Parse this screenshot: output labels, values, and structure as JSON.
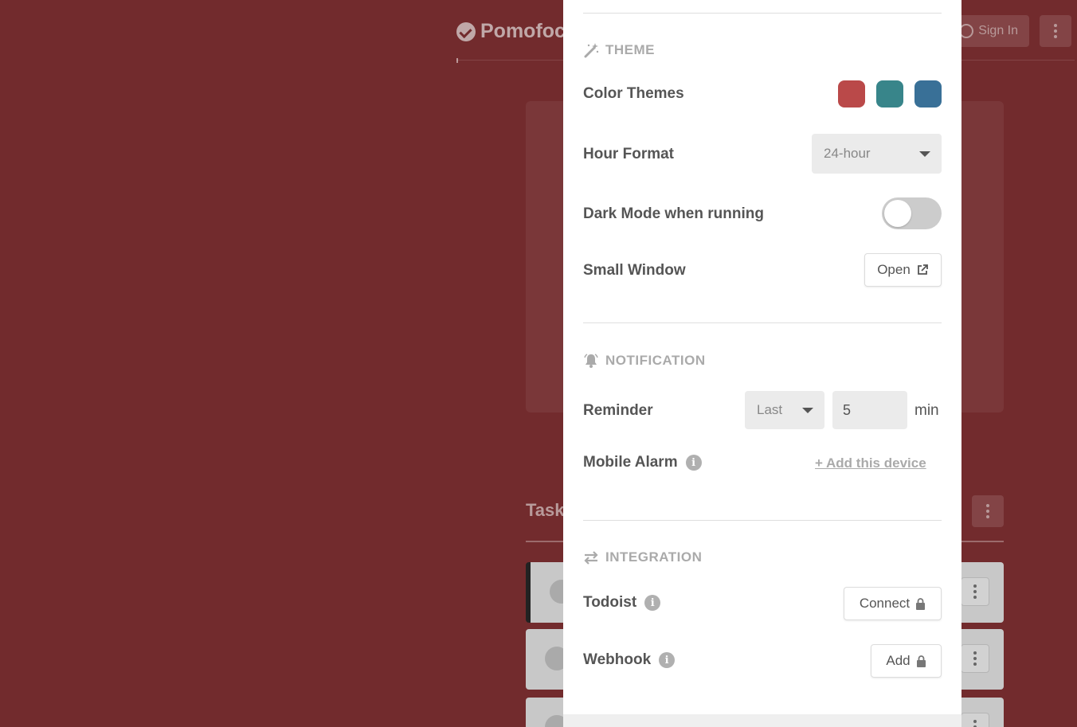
{
  "background": {
    "app_name": "Pomofoc",
    "signin_label": "Sign In",
    "tasks_label": "Task"
  },
  "theme": {
    "section_title": "THEME",
    "color_themes_label": "Color Themes",
    "swatches": [
      "#ba4949",
      "#38858a",
      "#397097"
    ],
    "hour_format_label": "Hour Format",
    "hour_format_value": "24-hour",
    "dark_mode_label": "Dark Mode when running",
    "dark_mode_on": false,
    "small_window_label": "Small Window",
    "small_window_button": "Open"
  },
  "notification": {
    "section_title": "NOTIFICATION",
    "reminder_label": "Reminder",
    "reminder_when": "Last",
    "reminder_minutes": "5",
    "reminder_unit": "min",
    "mobile_alarm_label": "Mobile Alarm",
    "add_device_link": "+ Add this device"
  },
  "integration": {
    "section_title": "INTEGRATION",
    "todoist_label": "Todoist",
    "todoist_button": "Connect",
    "webhook_label": "Webhook",
    "webhook_button": "Add"
  },
  "icons": {
    "info": "i"
  }
}
